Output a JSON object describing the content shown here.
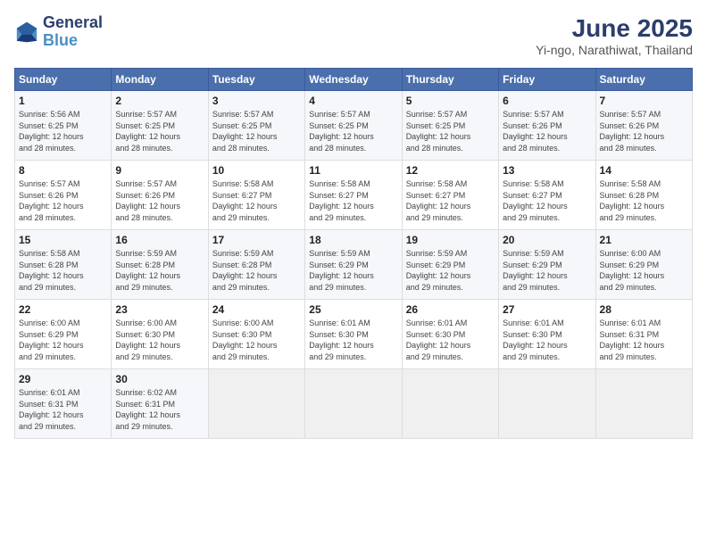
{
  "header": {
    "logo_general": "General",
    "logo_blue": "Blue",
    "title": "June 2025",
    "subtitle": "Yi-ngo, Narathiwat, Thailand"
  },
  "calendar": {
    "days_of_week": [
      "Sunday",
      "Monday",
      "Tuesday",
      "Wednesday",
      "Thursday",
      "Friday",
      "Saturday"
    ],
    "weeks": [
      [
        {
          "day": "",
          "info": ""
        },
        {
          "day": "2",
          "info": "Sunrise: 5:57 AM\nSunset: 6:25 PM\nDaylight: 12 hours\nand 28 minutes."
        },
        {
          "day": "3",
          "info": "Sunrise: 5:57 AM\nSunset: 6:25 PM\nDaylight: 12 hours\nand 28 minutes."
        },
        {
          "day": "4",
          "info": "Sunrise: 5:57 AM\nSunset: 6:25 PM\nDaylight: 12 hours\nand 28 minutes."
        },
        {
          "day": "5",
          "info": "Sunrise: 5:57 AM\nSunset: 6:25 PM\nDaylight: 12 hours\nand 28 minutes."
        },
        {
          "day": "6",
          "info": "Sunrise: 5:57 AM\nSunset: 6:26 PM\nDaylight: 12 hours\nand 28 minutes."
        },
        {
          "day": "7",
          "info": "Sunrise: 5:57 AM\nSunset: 6:26 PM\nDaylight: 12 hours\nand 28 minutes."
        }
      ],
      [
        {
          "day": "1",
          "info": "Sunrise: 5:56 AM\nSunset: 6:25 PM\nDaylight: 12 hours\nand 28 minutes."
        },
        {
          "day": "",
          "info": ""
        },
        {
          "day": "",
          "info": ""
        },
        {
          "day": "",
          "info": ""
        },
        {
          "day": "",
          "info": ""
        },
        {
          "day": "",
          "info": ""
        },
        {
          "day": "",
          "info": ""
        }
      ],
      [
        {
          "day": "8",
          "info": "Sunrise: 5:57 AM\nSunset: 6:26 PM\nDaylight: 12 hours\nand 28 minutes."
        },
        {
          "day": "9",
          "info": "Sunrise: 5:57 AM\nSunset: 6:26 PM\nDaylight: 12 hours\nand 28 minutes."
        },
        {
          "day": "10",
          "info": "Sunrise: 5:58 AM\nSunset: 6:27 PM\nDaylight: 12 hours\nand 29 minutes."
        },
        {
          "day": "11",
          "info": "Sunrise: 5:58 AM\nSunset: 6:27 PM\nDaylight: 12 hours\nand 29 minutes."
        },
        {
          "day": "12",
          "info": "Sunrise: 5:58 AM\nSunset: 6:27 PM\nDaylight: 12 hours\nand 29 minutes."
        },
        {
          "day": "13",
          "info": "Sunrise: 5:58 AM\nSunset: 6:27 PM\nDaylight: 12 hours\nand 29 minutes."
        },
        {
          "day": "14",
          "info": "Sunrise: 5:58 AM\nSunset: 6:28 PM\nDaylight: 12 hours\nand 29 minutes."
        }
      ],
      [
        {
          "day": "15",
          "info": "Sunrise: 5:58 AM\nSunset: 6:28 PM\nDaylight: 12 hours\nand 29 minutes."
        },
        {
          "day": "16",
          "info": "Sunrise: 5:59 AM\nSunset: 6:28 PM\nDaylight: 12 hours\nand 29 minutes."
        },
        {
          "day": "17",
          "info": "Sunrise: 5:59 AM\nSunset: 6:28 PM\nDaylight: 12 hours\nand 29 minutes."
        },
        {
          "day": "18",
          "info": "Sunrise: 5:59 AM\nSunset: 6:29 PM\nDaylight: 12 hours\nand 29 minutes."
        },
        {
          "day": "19",
          "info": "Sunrise: 5:59 AM\nSunset: 6:29 PM\nDaylight: 12 hours\nand 29 minutes."
        },
        {
          "day": "20",
          "info": "Sunrise: 5:59 AM\nSunset: 6:29 PM\nDaylight: 12 hours\nand 29 minutes."
        },
        {
          "day": "21",
          "info": "Sunrise: 6:00 AM\nSunset: 6:29 PM\nDaylight: 12 hours\nand 29 minutes."
        }
      ],
      [
        {
          "day": "22",
          "info": "Sunrise: 6:00 AM\nSunset: 6:29 PM\nDaylight: 12 hours\nand 29 minutes."
        },
        {
          "day": "23",
          "info": "Sunrise: 6:00 AM\nSunset: 6:30 PM\nDaylight: 12 hours\nand 29 minutes."
        },
        {
          "day": "24",
          "info": "Sunrise: 6:00 AM\nSunset: 6:30 PM\nDaylight: 12 hours\nand 29 minutes."
        },
        {
          "day": "25",
          "info": "Sunrise: 6:01 AM\nSunset: 6:30 PM\nDaylight: 12 hours\nand 29 minutes."
        },
        {
          "day": "26",
          "info": "Sunrise: 6:01 AM\nSunset: 6:30 PM\nDaylight: 12 hours\nand 29 minutes."
        },
        {
          "day": "27",
          "info": "Sunrise: 6:01 AM\nSunset: 6:30 PM\nDaylight: 12 hours\nand 29 minutes."
        },
        {
          "day": "28",
          "info": "Sunrise: 6:01 AM\nSunset: 6:31 PM\nDaylight: 12 hours\nand 29 minutes."
        }
      ],
      [
        {
          "day": "29",
          "info": "Sunrise: 6:01 AM\nSunset: 6:31 PM\nDaylight: 12 hours\nand 29 minutes."
        },
        {
          "day": "30",
          "info": "Sunrise: 6:02 AM\nSunset: 6:31 PM\nDaylight: 12 hours\nand 29 minutes."
        },
        {
          "day": "",
          "info": ""
        },
        {
          "day": "",
          "info": ""
        },
        {
          "day": "",
          "info": ""
        },
        {
          "day": "",
          "info": ""
        },
        {
          "day": "",
          "info": ""
        }
      ]
    ]
  }
}
